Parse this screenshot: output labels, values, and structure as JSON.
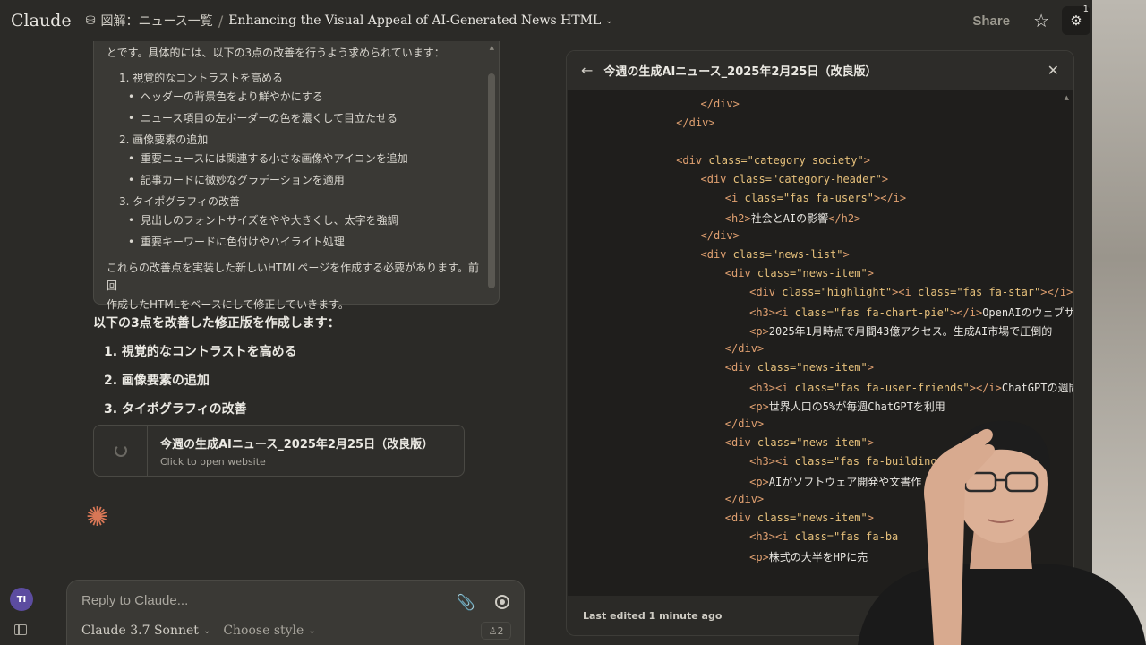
{
  "topbar": {
    "logo": "Claude",
    "project": "図解：ニュース一覧",
    "separator": "/",
    "chat_title": "Enhancing the Visual Appeal of AI-Generated News HTML",
    "share_label": "Share",
    "tune_badge": "1",
    "avatar_icon": "Ⓐ"
  },
  "thinking": {
    "lead": "とです。具体的には、以下の3点の改善を行うよう求められています：",
    "items": [
      {
        "label": "1. 視覚的なコントラストを高める",
        "subs": [
          "ヘッダーの背景色をより鮮やかにする",
          "ニュース項目の左ボーダーの色を濃くして目立たせる"
        ]
      },
      {
        "label": "2. 画像要素の追加",
        "subs": [
          "重要ニュースには関連する小さな画像やアイコンを追加",
          "記事カードに微妙なグラデーションを適用"
        ]
      },
      {
        "label": "3. タイポグラフィの改善",
        "subs": [
          "見出しのフォントサイズをやや大きくし、太字を強調",
          "重要キーワードに色付けやハイライト処理"
        ]
      }
    ],
    "tail_1": "これらの改善点を実装した新しいHTMLページを作成する必要があります。前回",
    "tail_2": "作成したHTMLをベースにして修正していきます。"
  },
  "reply": {
    "head": "以下の3点を改善した修正版を作成します：",
    "items": [
      "1. 視覚的なコントラストを高める",
      "2. 画像要素の追加",
      "3. タイポグラフィの改善"
    ]
  },
  "artifact": {
    "title": "今週の生成AIニュース_2025年2月25日（改良版）",
    "subtitle": "Click to open website"
  },
  "composer": {
    "placeholder": "Reply to Claude...",
    "model": "Claude 3.7 Sonnet",
    "style": "Choose style",
    "count": "2",
    "user_initials": "TI"
  },
  "panel": {
    "title": "今週の生成AIニュース_2025年2月25日（改良版）",
    "footer": "Last edited 1 minute ago",
    "code": [
      {
        "indent": 5,
        "parts": [
          [
            "tag",
            "</div>"
          ]
        ]
      },
      {
        "indent": 4,
        "parts": [
          [
            "tag",
            "</div>"
          ]
        ]
      },
      {
        "indent": 0,
        "parts": []
      },
      {
        "indent": 4,
        "parts": [
          [
            "tag",
            "<div "
          ],
          [
            "attr",
            "class="
          ],
          [
            "str",
            "\"category society\""
          ],
          [
            "tag",
            ">"
          ]
        ]
      },
      {
        "indent": 5,
        "parts": [
          [
            "tag",
            "<div "
          ],
          [
            "attr",
            "class="
          ],
          [
            "str",
            "\"category-header\""
          ],
          [
            "tag",
            ">"
          ]
        ]
      },
      {
        "indent": 6,
        "parts": [
          [
            "tag",
            "<i "
          ],
          [
            "attr",
            "class="
          ],
          [
            "str",
            "\"fas fa-users\""
          ],
          [
            "tag",
            "></i>"
          ]
        ]
      },
      {
        "indent": 6,
        "parts": [
          [
            "tag",
            "<h2>"
          ],
          [
            "txt",
            "社会とAIの影響"
          ],
          [
            "tag",
            "</h2>"
          ]
        ]
      },
      {
        "indent": 5,
        "parts": [
          [
            "tag",
            "</div>"
          ]
        ]
      },
      {
        "indent": 5,
        "parts": [
          [
            "tag",
            "<div "
          ],
          [
            "attr",
            "class="
          ],
          [
            "str",
            "\"news-list\""
          ],
          [
            "tag",
            ">"
          ]
        ]
      },
      {
        "indent": 6,
        "parts": [
          [
            "tag",
            "<div "
          ],
          [
            "attr",
            "class="
          ],
          [
            "str",
            "\"news-item\""
          ],
          [
            "tag",
            ">"
          ]
        ]
      },
      {
        "indent": 7,
        "parts": [
          [
            "tag",
            "<div "
          ],
          [
            "attr",
            "class="
          ],
          [
            "str",
            "\"highlight\""
          ],
          [
            "tag",
            "><i "
          ],
          [
            "attr",
            "class="
          ],
          [
            "str",
            "\"fas fa-star\""
          ],
          [
            "tag",
            "></i></"
          ]
        ]
      },
      {
        "indent": 7,
        "parts": [
          [
            "tag",
            "<h3><i "
          ],
          [
            "attr",
            "class="
          ],
          [
            "str",
            "\"fas fa-chart-pie\""
          ],
          [
            "tag",
            "></i>"
          ],
          [
            "txt",
            "OpenAIのウェブサ"
          ]
        ]
      },
      {
        "indent": 7,
        "parts": [
          [
            "tag",
            "<p>"
          ],
          [
            "txt",
            "2025年1月時点で月間43億アクセス。生成AI市場で圧倒的"
          ]
        ]
      },
      {
        "indent": 6,
        "parts": [
          [
            "tag",
            "</div>"
          ]
        ]
      },
      {
        "indent": 6,
        "parts": [
          [
            "tag",
            "<div "
          ],
          [
            "attr",
            "class="
          ],
          [
            "str",
            "\"news-item\""
          ],
          [
            "tag",
            ">"
          ]
        ]
      },
      {
        "indent": 7,
        "parts": [
          [
            "tag",
            "<h3><i "
          ],
          [
            "attr",
            "class="
          ],
          [
            "str",
            "\"fas fa-user-friends\""
          ],
          [
            "tag",
            "></i>"
          ],
          [
            "txt",
            "ChatGPTの週間"
          ]
        ]
      },
      {
        "indent": 7,
        "parts": [
          [
            "tag",
            "<p>"
          ],
          [
            "txt",
            "世界人口の5%が毎週ChatGPTを利用"
          ]
        ]
      },
      {
        "indent": 6,
        "parts": [
          [
            "tag",
            "</div>"
          ]
        ]
      },
      {
        "indent": 6,
        "parts": [
          [
            "tag",
            "<div "
          ],
          [
            "attr",
            "class="
          ],
          [
            "str",
            "\"news-item\""
          ],
          [
            "tag",
            ">"
          ]
        ]
      },
      {
        "indent": 7,
        "parts": [
          [
            "tag",
            "<h3><i "
          ],
          [
            "attr",
            "class="
          ],
          [
            "str",
            "\"fas fa-building"
          ]
        ]
      },
      {
        "indent": 7,
        "parts": [
          [
            "tag",
            "<p>"
          ],
          [
            "txt",
            "AIがソフトウェア開発や文書作"
          ]
        ]
      },
      {
        "indent": 6,
        "parts": [
          [
            "tag",
            "</div>"
          ]
        ]
      },
      {
        "indent": 6,
        "parts": [
          [
            "tag",
            "<div "
          ],
          [
            "attr",
            "class="
          ],
          [
            "str",
            "\"news-item\""
          ],
          [
            "tag",
            ">"
          ]
        ]
      },
      {
        "indent": 7,
        "parts": [
          [
            "tag",
            "<h3><i "
          ],
          [
            "attr",
            "class="
          ],
          [
            "str",
            "\"fas fa-ba"
          ]
        ]
      },
      {
        "indent": 7,
        "parts": [
          [
            "tag",
            "<p>"
          ],
          [
            "txt",
            "株式の大半をHPに売"
          ]
        ]
      }
    ]
  },
  "icons": {
    "back": "←",
    "close": "✕",
    "star": "☆",
    "tune": "⚙",
    "clip": "📎",
    "sparkle": "✺",
    "project": "⛁",
    "chevron": "⌄"
  }
}
